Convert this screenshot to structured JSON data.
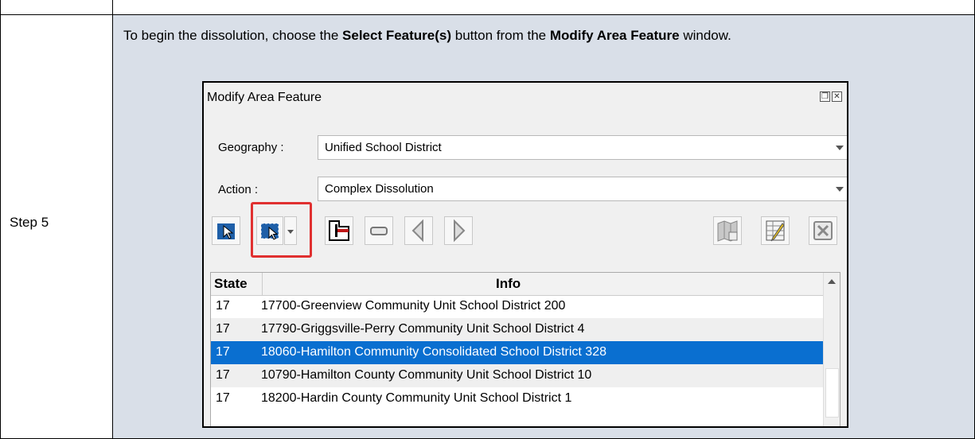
{
  "step": {
    "label": "Step 5"
  },
  "instruction": {
    "part1": "To begin the dissolution, choose the ",
    "bold1": "Select Feature(s)",
    "part2": " button from the ",
    "bold2": "Modify Area Feature",
    "part3": " window."
  },
  "window": {
    "title": "Modify Area Feature",
    "restore_icon": "restore-icon",
    "close_icon": "close-icon",
    "geography": {
      "label": "Geography :",
      "value": "Unified School District"
    },
    "action": {
      "label": "Action :",
      "value": "Complex Dissolution"
    },
    "toolbar": [
      "select-cursor-icon",
      "select-features-icon",
      "dropdown-arrow-icon",
      "split-feature-icon",
      "minus-icon",
      "previous-icon",
      "next-icon",
      "map-icon",
      "edit-table-icon",
      "clear-icon"
    ],
    "table": {
      "headers": [
        "State",
        "Info"
      ],
      "rows": [
        {
          "state": "17",
          "info": "17700-Greenview Community Unit School District 200",
          "selected": false
        },
        {
          "state": "17",
          "info": "17790-Griggsville-Perry Community Unit School District 4",
          "selected": false
        },
        {
          "state": "17",
          "info": "18060-Hamilton Community Consolidated School District 328",
          "selected": true
        },
        {
          "state": "17",
          "info": "10790-Hamilton County Community Unit School District 10",
          "selected": false
        },
        {
          "state": "17",
          "info": "18200-Hardin County Community Unit School District 1",
          "selected": false
        }
      ]
    }
  },
  "colors": {
    "cell_bg": "#d9dfe8",
    "selection": "#0a6fd0",
    "highlight_box": "#e03030"
  }
}
